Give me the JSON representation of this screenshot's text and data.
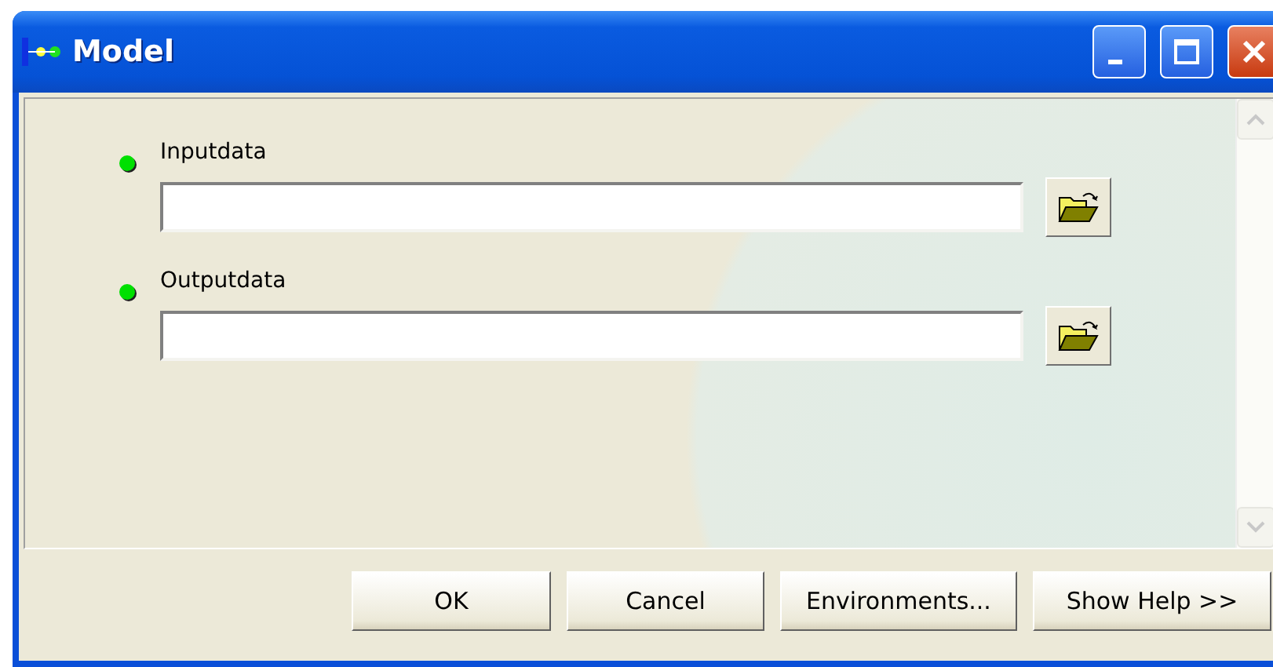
{
  "window": {
    "title": "Model"
  },
  "parameters": [
    {
      "label": "Inputdata",
      "required": true
    },
    {
      "label": "Outputdata",
      "required": true
    }
  ],
  "buttons": [
    {
      "label": "OK"
    },
    {
      "label": "Cancel"
    },
    {
      "label": "Environments..."
    },
    {
      "label": "Show Help >>"
    }
  ]
}
